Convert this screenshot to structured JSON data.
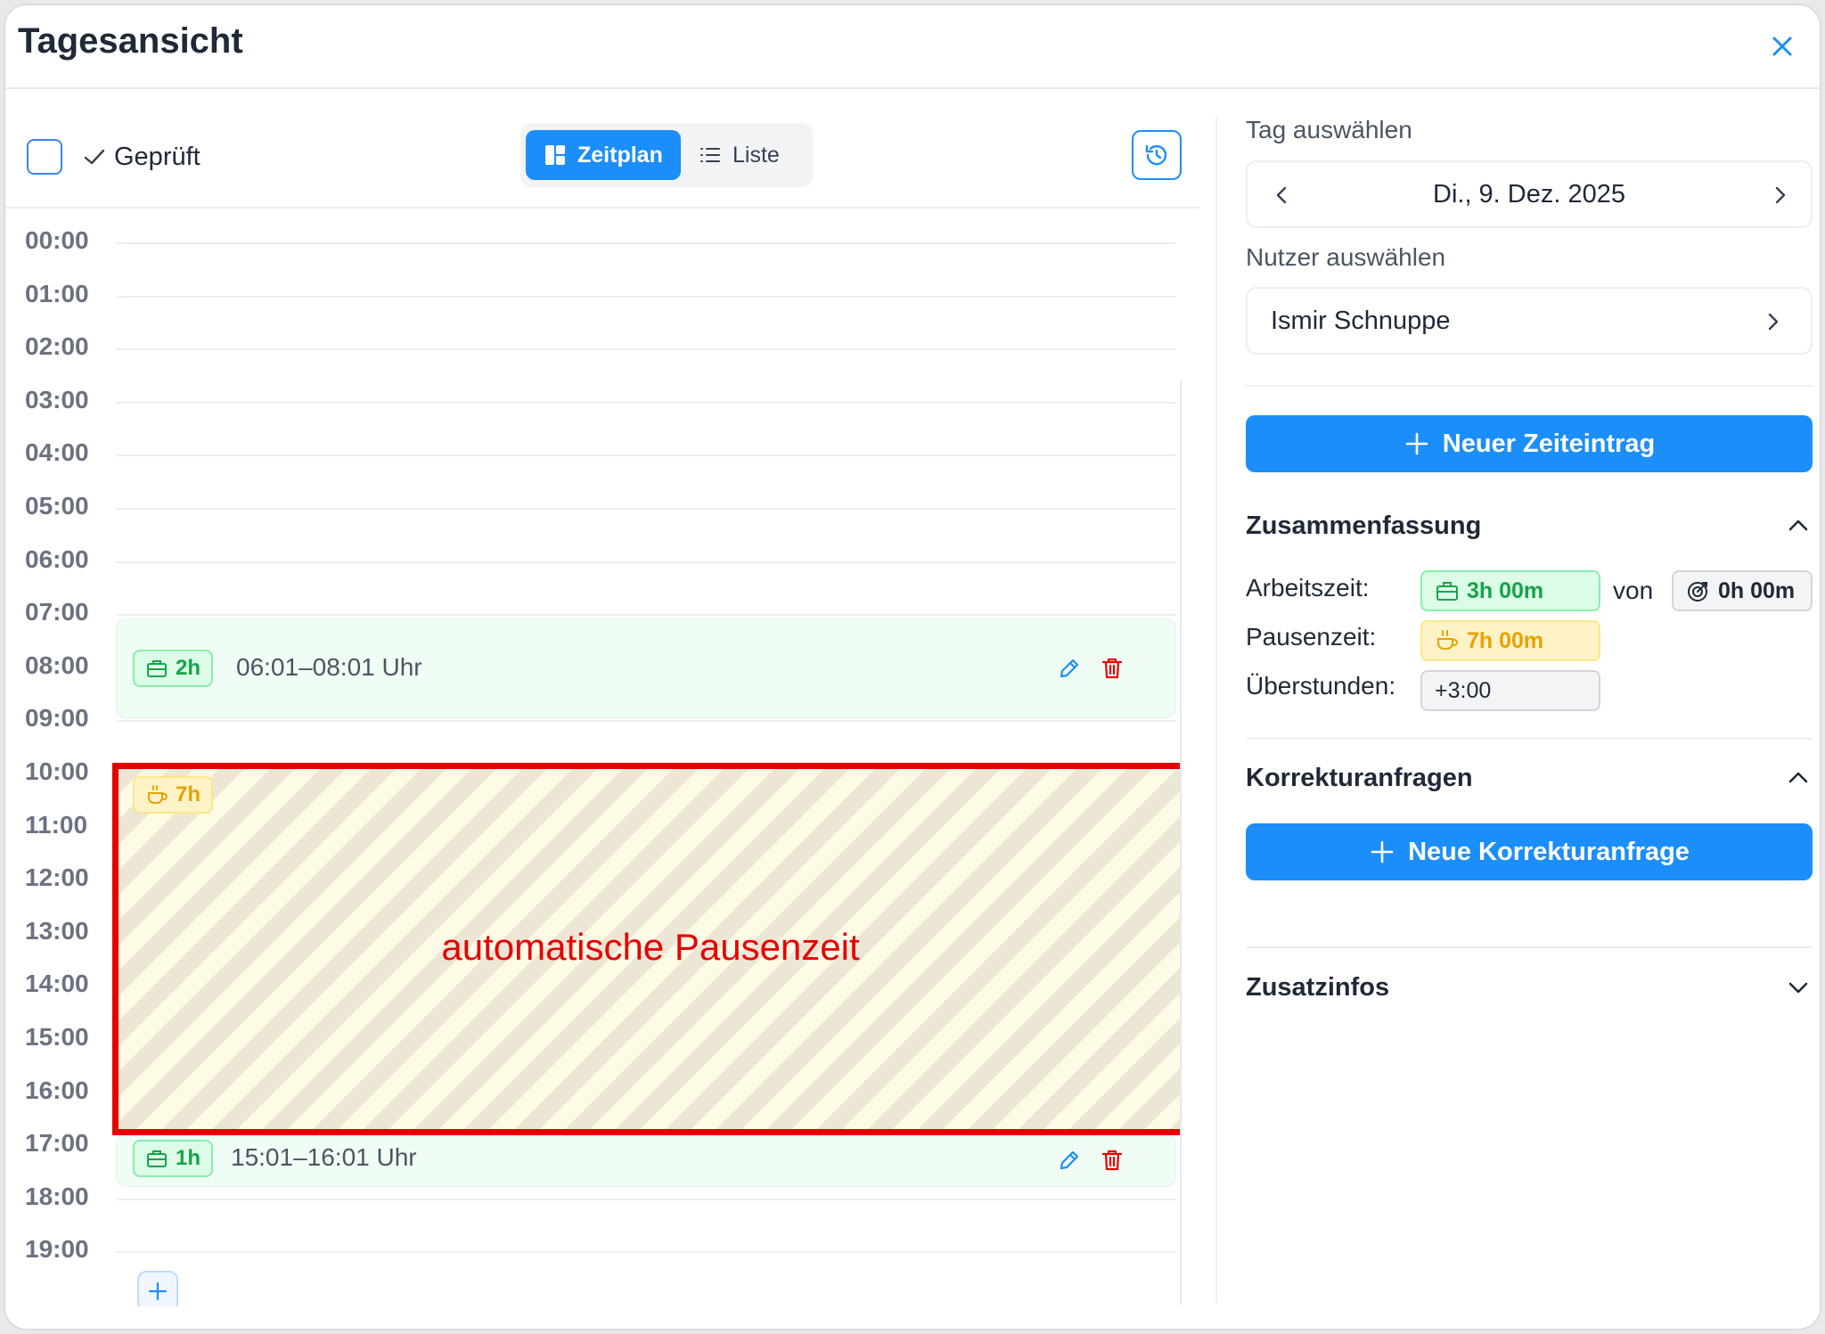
{
  "header": {
    "title": "Tagesansicht"
  },
  "toolbar": {
    "checked_label": "Geprüft",
    "view_schedule": "Zeitplan",
    "view_list": "Liste"
  },
  "timeline": {
    "hours": [
      "00:00",
      "01:00",
      "02:00",
      "03:00",
      "04:00",
      "05:00",
      "06:00",
      "07:00",
      "08:00",
      "09:00",
      "10:00",
      "11:00",
      "12:00",
      "13:00",
      "14:00",
      "15:00",
      "16:00",
      "17:00",
      "18:00",
      "19:00"
    ],
    "entries": [
      {
        "duration": "2h",
        "time": "06:01–08:01 Uhr"
      },
      {
        "duration": "1h",
        "time": "15:01–16:01 Uhr"
      }
    ],
    "pause": {
      "duration": "7h",
      "label": "automatische Pausenzeit"
    }
  },
  "sidebar": {
    "day_label": "Tag auswählen",
    "date": "Di., 9. Dez. 2025",
    "user_label": "Nutzer auswählen",
    "user": "Ismir Schnuppe",
    "new_entry": "Neuer Zeiteintrag",
    "summary": {
      "title": "Zusammenfassung",
      "work_label": "Arbeitszeit:",
      "work_value": "3h 00m",
      "of": "von",
      "target_value": "0h 00m",
      "pause_label": "Pausenzeit:",
      "pause_value": "7h 00m",
      "overtime_label": "Überstunden:",
      "overtime_value": "+3:00"
    },
    "corrections": {
      "title": "Korrekturanfragen",
      "new_request": "Neue Korrekturanfrage"
    },
    "extra": {
      "title": "Zusatzinfos"
    }
  },
  "colors": {
    "primary": "#1c8ef9",
    "work": "#16a34a",
    "pause": "#e8a200",
    "danger": "#e60000"
  }
}
